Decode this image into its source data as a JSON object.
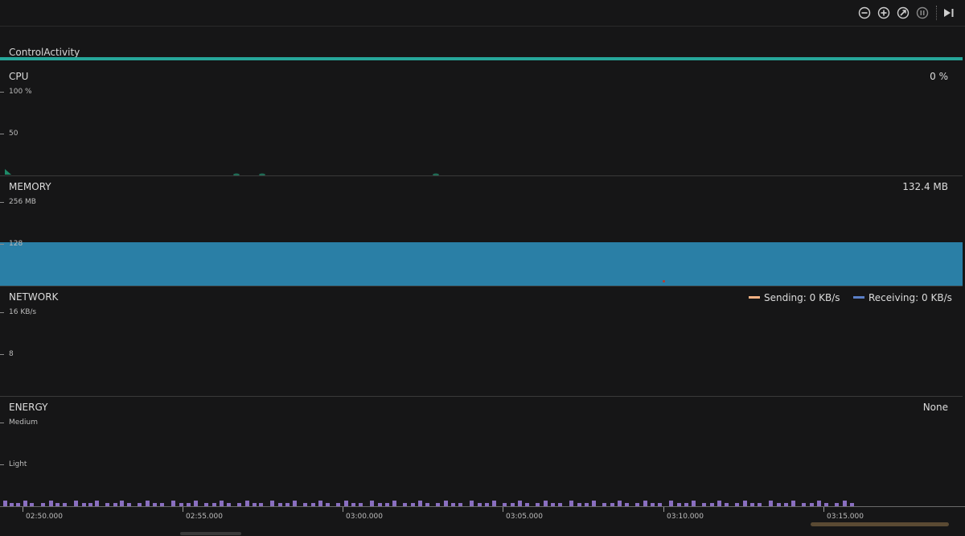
{
  "toolbar": {
    "buttons": [
      {
        "name": "zoom-out-icon"
      },
      {
        "name": "zoom-in-icon"
      },
      {
        "name": "reset-zoom-icon"
      },
      {
        "name": "pause-icon"
      },
      {
        "name": "go-live-icon"
      }
    ],
    "accent_color": "#e48b3a"
  },
  "activity": {
    "label": "ControlActivity",
    "color": "#26a69a"
  },
  "cpu": {
    "title": "CPU",
    "value": "0 %",
    "axis": [
      "100 %",
      "50"
    ]
  },
  "memory": {
    "title": "MEMORY",
    "value": "132.4 MB",
    "axis": [
      "256 MB",
      "128"
    ],
    "fill_color": "#2a7fa6"
  },
  "network": {
    "title": "NETWORK",
    "axis": [
      "16 KB/s",
      "8"
    ],
    "legend": [
      {
        "label": "Sending: 0 KB/s",
        "color": "#f4b183"
      },
      {
        "label": "Receiving: 0 KB/s",
        "color": "#5b7fc7"
      }
    ]
  },
  "energy": {
    "title": "ENERGY",
    "value": "None",
    "axis": [
      "Medium",
      "Light"
    ],
    "bar_color": "#8a6fc0"
  },
  "timeline": {
    "labels": [
      "02:50.000",
      "02:55.000",
      "03:00.000",
      "03:05.000",
      "03:10.000",
      "03:15.000"
    ]
  }
}
